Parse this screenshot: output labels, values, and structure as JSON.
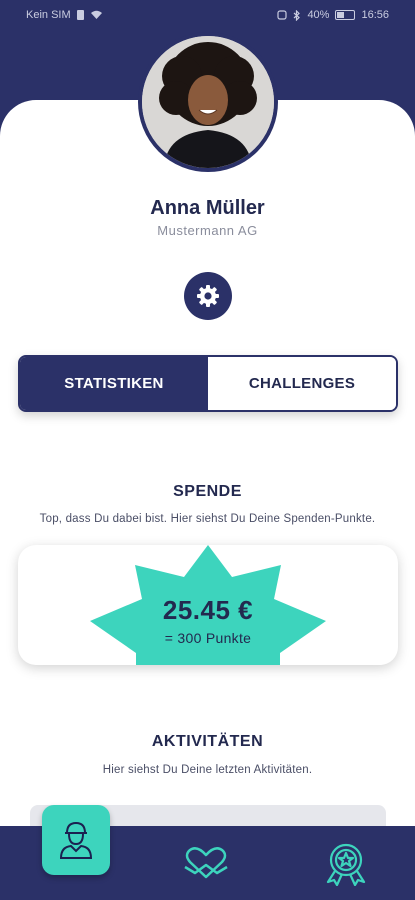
{
  "status_bar": {
    "carrier": "Kein SIM",
    "battery": "40%",
    "time": "16:56"
  },
  "profile": {
    "name": "Anna Müller",
    "company": "Mustermann AG"
  },
  "tabs": [
    {
      "label": "STATISTIKEN",
      "active": true
    },
    {
      "label": "CHALLENGES",
      "active": false
    }
  ],
  "donation": {
    "title": "SPENDE",
    "subtitle": "Top, dass Du dabei bist. Hier siehst Du Deine Spenden-Punkte.",
    "amount": "25.45 €",
    "points": "= 300 Punkte"
  },
  "activities": {
    "title": "AKTIVITÄTEN",
    "subtitle": "Hier siehst Du Deine letzten Aktivitäten."
  },
  "colors": {
    "primary": "#2b3168",
    "accent": "#3dd4bd",
    "background": "#ffffff"
  },
  "nav": {
    "items": [
      "profile-icon",
      "heart-hands-icon",
      "award-badge-icon"
    ]
  }
}
